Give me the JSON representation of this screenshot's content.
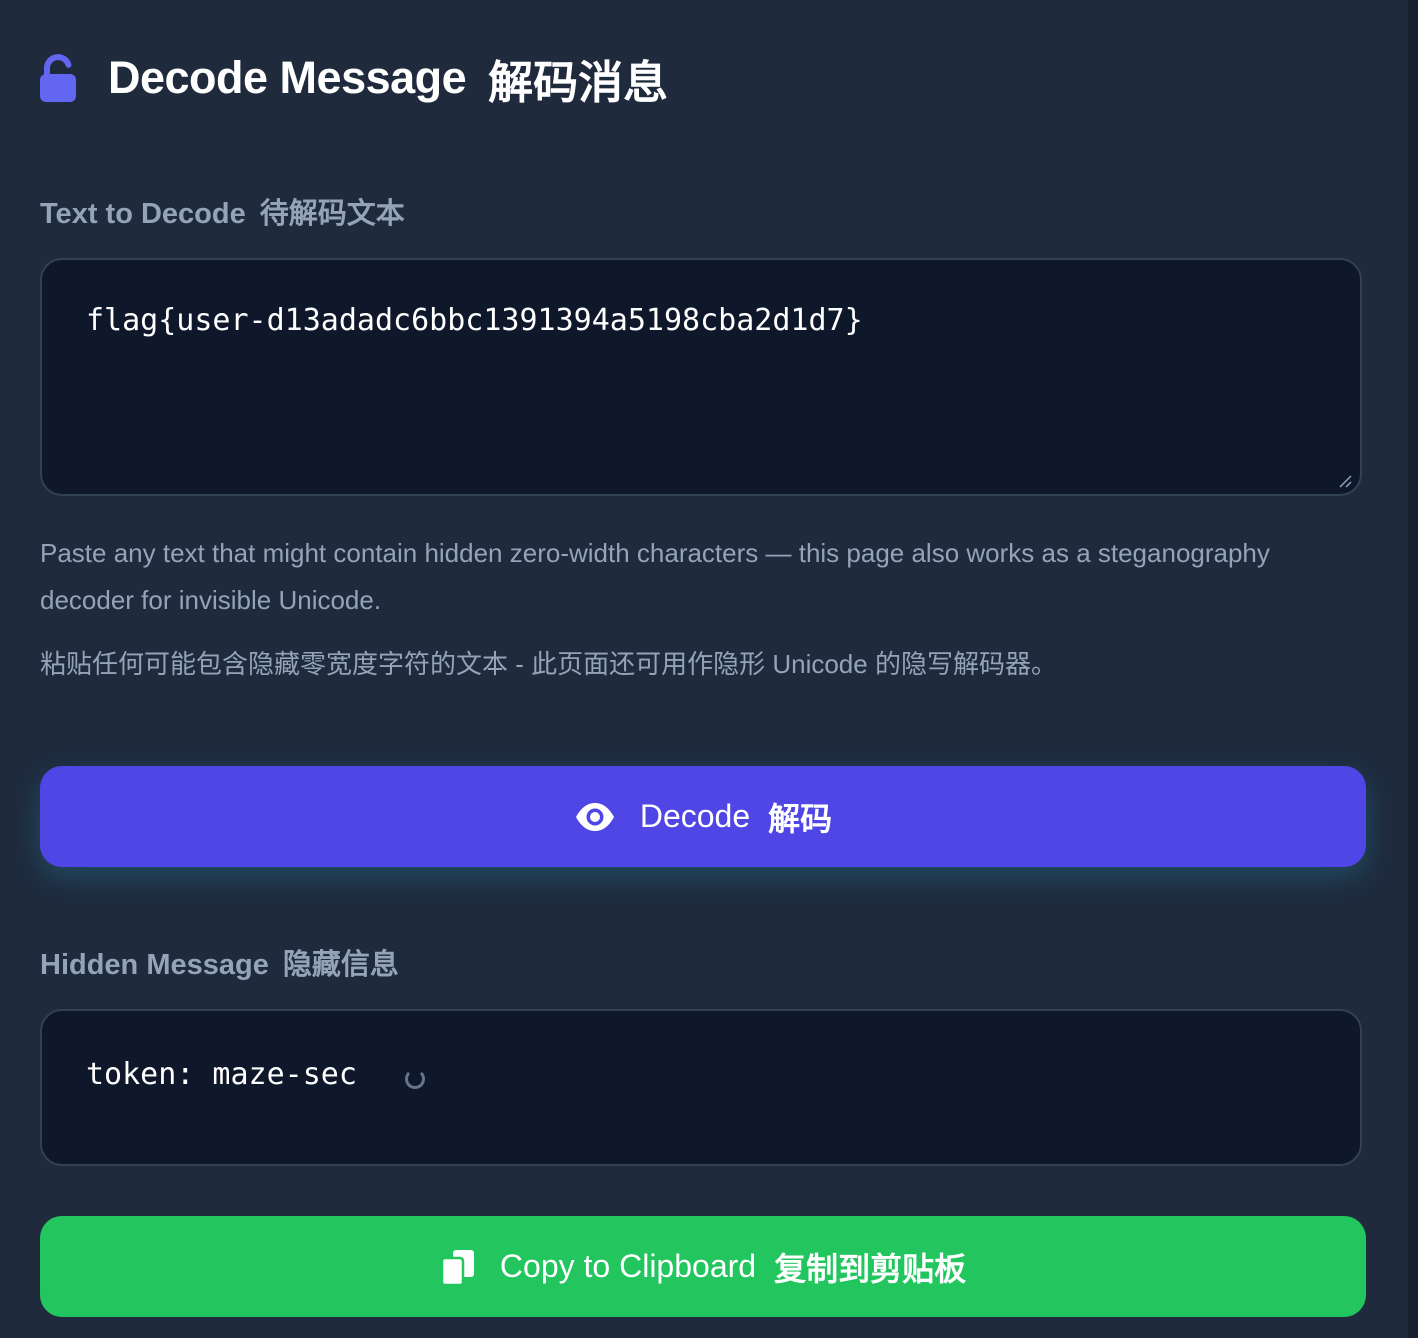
{
  "header": {
    "title_en": "Decode Message",
    "title_zh": "解码消息",
    "icon": "lock-open-icon"
  },
  "input": {
    "label_en": "Text to Decode",
    "label_zh": "待解码文本",
    "value": "flag{user-d13adadc6bbc1391394a5198cba2d1d7}"
  },
  "help": {
    "en": "Paste any text that might contain hidden zero-width characters — this page also works as a steganography decoder for invisible Unicode.",
    "zh": "粘贴任何可能包含隐藏零宽度字符的文本 - 此页面还可用作隐形 Unicode 的隐写解码器。"
  },
  "decode_button": {
    "label_en": "Decode",
    "label_zh": "解码",
    "icon": "eye-icon",
    "color": "#4f46e5"
  },
  "output": {
    "label_en": "Hidden Message",
    "label_zh": "隐藏信息",
    "value": "token: maze-sec"
  },
  "copy_button": {
    "label_en": "Copy to Clipboard",
    "label_zh": "复制到剪贴板",
    "icon": "copy-icon",
    "color": "#22c55e"
  }
}
